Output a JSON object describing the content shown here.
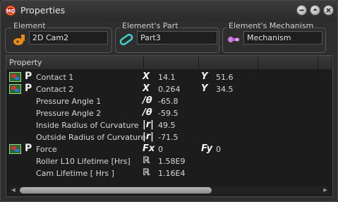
{
  "window": {
    "title": "Properties"
  },
  "element_group": {
    "label": "Element",
    "value": "2D Cam2"
  },
  "part_group": {
    "label": "Element's Part",
    "value": "Part3"
  },
  "mechanism_group": {
    "label": "Element's Mechanism",
    "value": "Mechanism"
  },
  "table": {
    "header": "Property",
    "rows": [
      {
        "kind": "load",
        "label": "Contact 1",
        "sym1": "X",
        "val1": "14.1",
        "sym2": "Y",
        "val2": "51.6"
      },
      {
        "kind": "load",
        "label": "Contact 2",
        "sym1": "X",
        "val1": "0.264",
        "sym2": "Y",
        "val2": "34.5"
      },
      {
        "kind": "plain",
        "label": "Pressure Angle 1",
        "sym1": "/θ",
        "val1": "-65.8"
      },
      {
        "kind": "plain",
        "label": "Pressure Angle 2",
        "sym1": "/θ",
        "val1": "-59.5"
      },
      {
        "kind": "plain",
        "label": "Inside Radius of Curvature",
        "sym1": "|r|",
        "val1": "49.5"
      },
      {
        "kind": "plain",
        "label": "Outside Radius of Curvature",
        "sym1": "|r|",
        "val1": "-71.5"
      },
      {
        "kind": "load",
        "label": "Force",
        "sym1": "Fx",
        "val1": "0",
        "sym2": "Fy",
        "val2": "0"
      },
      {
        "kind": "plain",
        "label": "Roller L10 Lifetime [Hrs]",
        "sym1": "ℝ",
        "val1": "1.58E9"
      },
      {
        "kind": "plain",
        "label": "Cam Lifetime [ Hrs ]",
        "sym1": "ℝ",
        "val1": "1.16E4"
      }
    ]
  },
  "colors": {
    "accent": "#e07b10",
    "part_icon": "#3fd0d0",
    "mech_icon": "#d080e0"
  }
}
